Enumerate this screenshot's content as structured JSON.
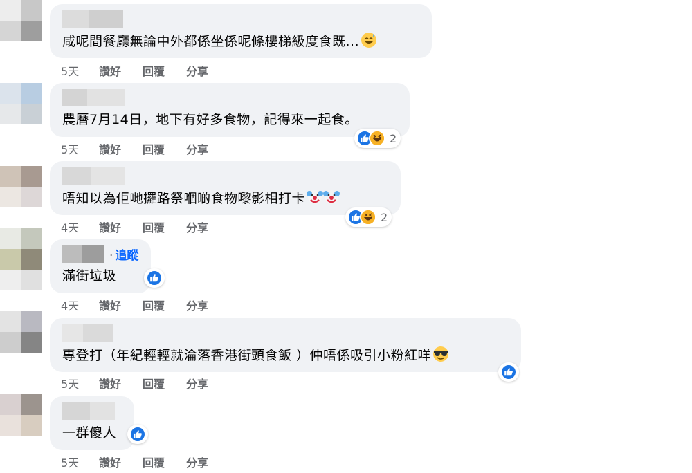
{
  "comments": [
    {
      "text": "咸呢間餐廳無論中外都係坐係呢條樓梯級度食既...",
      "time": "5天",
      "like": "讚好",
      "reply": "回覆",
      "share": "分享",
      "emoji": "sweat-smile-emoji"
    },
    {
      "text": "農曆7月14日，地下有好多食物，記得來一起食。",
      "time": "5天",
      "like": "讚好",
      "reply": "回覆",
      "share": "分享",
      "reaction_count": "2",
      "reactions": [
        "like",
        "haha"
      ]
    },
    {
      "text": "唔知以為佢哋攞路祭嗰啲食物嚟影相打卡",
      "time": "4天",
      "like": "讚好",
      "reply": "回覆",
      "share": "分享",
      "emoji": "clown-emoji",
      "reaction_count": "2",
      "reactions": [
        "like",
        "haha"
      ]
    },
    {
      "text": "滿街垃圾",
      "time": "4天",
      "like": "讚好",
      "reply": "回覆",
      "share": "分享",
      "follow": "追蹤",
      "reactions": [
        "like"
      ]
    },
    {
      "text": "專登打（年紀輕輕就淪落香港街頭食飯 ）仲唔係吸引小粉紅咩",
      "time": "5天",
      "like": "讚好",
      "reply": "回覆",
      "share": "分享",
      "emoji": "sunglasses-emoji",
      "reactions": [
        "like"
      ]
    },
    {
      "text": "一群傻人",
      "time": "5天",
      "like": "讚好",
      "reply": "回覆",
      "share": "分享",
      "reactions": [
        "like"
      ]
    }
  ],
  "colors": {
    "bubble": "#f0f2f5",
    "link": "#0866ff",
    "meta": "#65676b",
    "like": "#1b74e4",
    "haha": "#f7b125"
  }
}
